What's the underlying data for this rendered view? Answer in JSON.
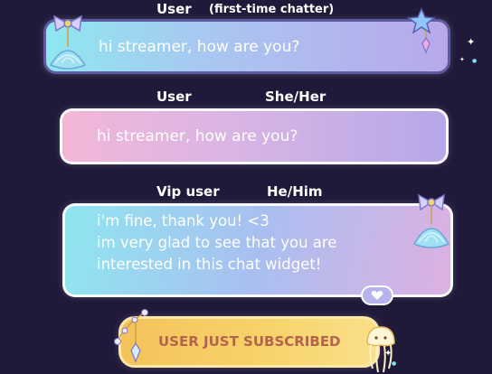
{
  "messages": [
    {
      "username": "User",
      "tag": "(first-time chatter)",
      "text": "hi streamer, how are you?"
    },
    {
      "username": "User",
      "pronouns": "She/Her",
      "text": "hi streamer, how are you?"
    },
    {
      "username": "Vip user",
      "pronouns": "He/Him",
      "lines": [
        "i'm fine, thank you! <3",
        "im very glad to see that you are",
        "interested in this chat widget!"
      ],
      "badge_icon": "heart-icon"
    }
  ],
  "alert": {
    "text": "USER JUST SUBSCRIBED",
    "icon": "jellyfish-icon"
  },
  "decorations": {
    "icons": [
      "shell-icon",
      "star-icon",
      "crystal-charm-icon",
      "bead-chain-icon",
      "sparkle-icon"
    ]
  },
  "colors": {
    "background": "#20193a",
    "first_chat_border": "#5e5aa0",
    "alert_text": "#b4634c"
  }
}
